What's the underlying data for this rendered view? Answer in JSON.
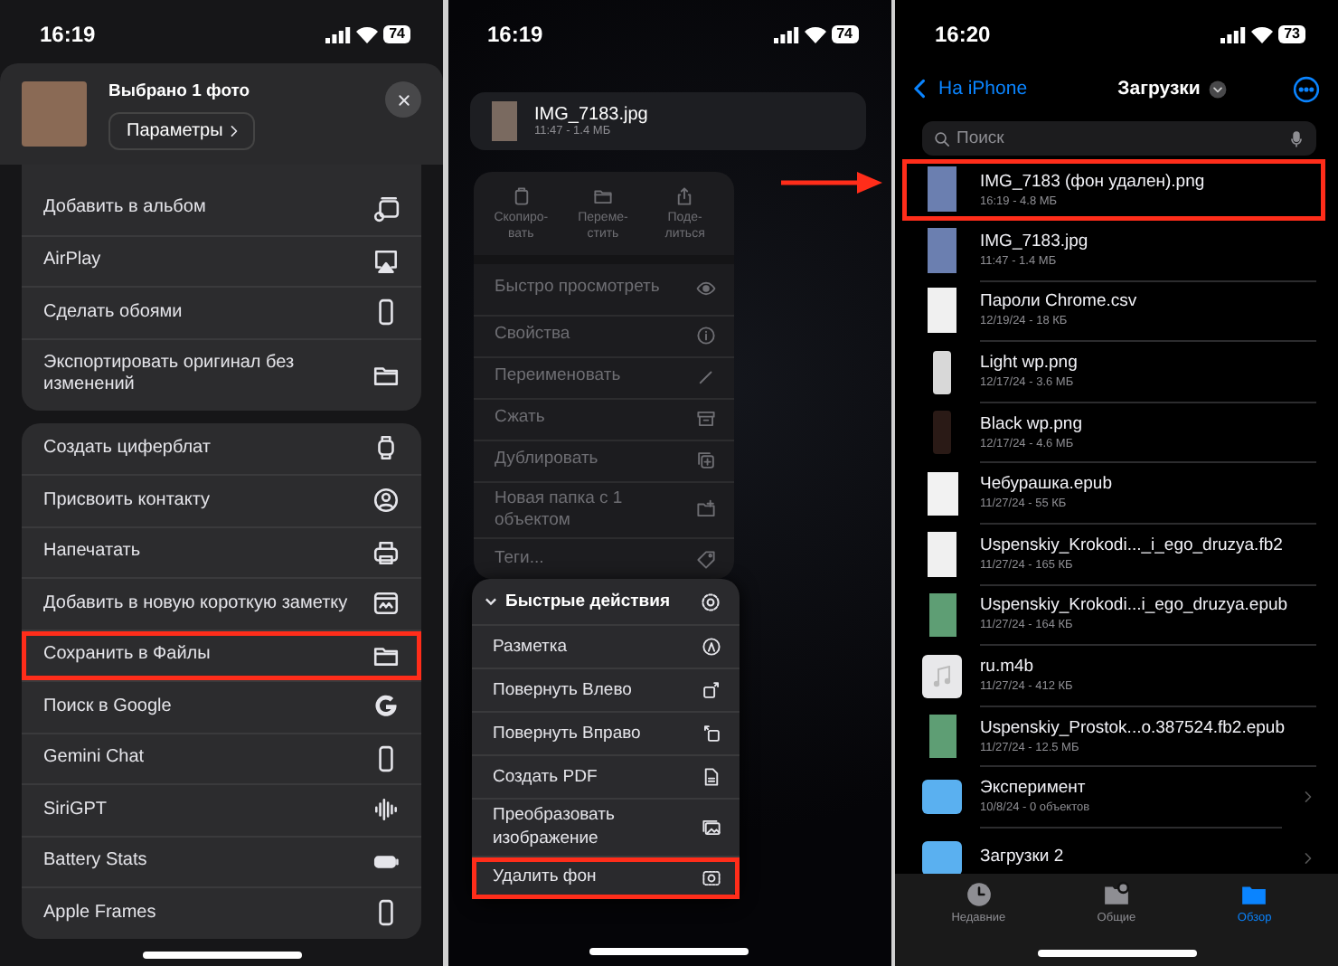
{
  "share_sheet": {
    "status_bar": {
      "time": "16:19",
      "battery": "74"
    },
    "header": {
      "title": "Выбрано 1 фото",
      "options_button": "Параметры"
    },
    "groups": [
      {
        "items": [
          {
            "label": "Добавить в альбом",
            "highlighted": false
          },
          {
            "label": "AirPlay",
            "highlighted": false
          },
          {
            "label": "Сделать обоями",
            "highlighted": false
          },
          {
            "label": "Экспортировать оригинал без изменений",
            "highlighted": false
          }
        ]
      },
      {
        "items": [
          {
            "label": "Создать циферблат",
            "highlighted": false
          },
          {
            "label": "Присвоить контакту",
            "highlighted": false
          },
          {
            "label": "Напечатать",
            "highlighted": false
          },
          {
            "label": "Добавить в новую короткую заметку",
            "highlighted": false
          },
          {
            "label": "Сохранить в Файлы",
            "highlighted": true
          },
          {
            "label": "Поиск в Google",
            "highlighted": false
          },
          {
            "label": "Gemini Chat",
            "highlighted": false
          },
          {
            "label": "SiriGPT",
            "highlighted": false
          },
          {
            "label": "Battery Stats",
            "highlighted": false
          },
          {
            "label": "Apple Frames",
            "highlighted": false
          }
        ]
      }
    ]
  },
  "file_menu": {
    "status_bar": {
      "time": "16:19",
      "battery": "74"
    },
    "file": {
      "name": "IMG_7183.jpg",
      "meta": "11:47 - 1.4 МБ"
    },
    "dimmed": true,
    "actions": [
      {
        "label": "Скопиро-вать"
      },
      {
        "label": "Переме-стить"
      },
      {
        "label": "Поде-литься"
      }
    ],
    "items": [
      {
        "label": "Быстро просмотреть"
      },
      {
        "label": "Свойства"
      },
      {
        "label": "Переименовать"
      },
      {
        "label": "Сжать"
      },
      {
        "label": "Дублировать"
      },
      {
        "label": "Новая папка с 1 объектом"
      },
      {
        "label": "Теги..."
      }
    ],
    "quick_actions": {
      "title": "Быстрые действия",
      "expanded": true,
      "items": [
        {
          "label": "Разметка",
          "highlighted": false
        },
        {
          "label": "Повернуть Влево",
          "highlighted": false
        },
        {
          "label": "Повернуть Вправо",
          "highlighted": false
        },
        {
          "label": "Создать PDF",
          "highlighted": false
        },
        {
          "label": "Преобразовать изображение",
          "highlighted": false
        },
        {
          "label": "Удалить фон",
          "highlighted": true
        }
      ]
    }
  },
  "files_browser": {
    "status_bar": {
      "time": "16:20",
      "battery": "73"
    },
    "back": "На iPhone",
    "title": "Загрузки",
    "search": {
      "placeholder": "Поиск"
    },
    "files": [
      {
        "name": "IMG_7183 (фон удален).png",
        "meta": "16:19 - 4.8 МБ",
        "kind": "photo",
        "highlighted": true
      },
      {
        "name": "IMG_7183.jpg",
        "meta": "11:47 - 1.4 МБ",
        "kind": "photo",
        "highlighted": false
      },
      {
        "name": "Пароли Chrome.csv",
        "meta": "12/19/24 - 18 КБ",
        "kind": "document",
        "highlighted": false
      },
      {
        "name": "Light wp.png",
        "meta": "12/17/24 - 3.6 МБ",
        "kind": "light-image",
        "highlighted": false
      },
      {
        "name": "Black wp.png",
        "meta": "12/17/24 - 4.6 МБ",
        "kind": "dark-image",
        "highlighted": false
      },
      {
        "name": "Чебурашка.epub",
        "meta": "11/27/24 - 55 КБ",
        "kind": "book",
        "highlighted": false
      },
      {
        "name": "Uspenskiy_Krokodi..._i_ego_druzya.fb2",
        "meta": "11/27/24 - 165 КБ",
        "kind": "document",
        "highlighted": false
      },
      {
        "name": "Uspenskiy_Krokodi...i_ego_druzya.epub",
        "meta": "11/27/24 - 164 КБ",
        "kind": "cover",
        "highlighted": false
      },
      {
        "name": "ru.m4b",
        "meta": "11/27/24 - 412 КБ",
        "kind": "audio",
        "highlighted": false
      },
      {
        "name": "Uspenskiy_Prostok...o.387524.fb2.epub",
        "meta": "11/27/24 - 12.5 МБ",
        "kind": "cover",
        "highlighted": false
      },
      {
        "name": "Эксперимент",
        "meta": "10/8/24 - 0 объектов",
        "kind": "folder",
        "highlighted": false
      },
      {
        "name": "Загрузки 2",
        "kind": "folder",
        "highlighted": false
      }
    ],
    "tabs": [
      {
        "label": "Недавние",
        "selected": false
      },
      {
        "label": "Общие",
        "selected": false
      },
      {
        "label": "Обзор",
        "selected": true
      }
    ]
  }
}
